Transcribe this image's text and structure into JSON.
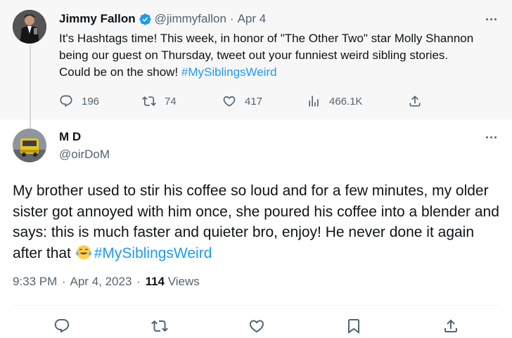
{
  "parent_tweet": {
    "display_name": "Jimmy Fallon",
    "handle": "@jimmyfallon",
    "separator": "·",
    "date": "Apr 4",
    "text_before": "It's Hashtags time! This week, in honor of \"The Other Two\" star Molly Shannon being our guest on Thursday, tweet out your funniest weird sibling stories. Could be on the show! ",
    "hashtag": "#MySiblingsWeird",
    "stats": {
      "replies": "196",
      "retweets": "74",
      "likes": "417",
      "views": "466.1K"
    }
  },
  "reply_tweet": {
    "display_name": "M D",
    "handle": "@oirDoM",
    "text_before": "My brother used to stir his coffee so loud and for a few minutes, my older sister got annoyed with him once, she poured his coffee into a blender and says: this is much faster and quieter bro, enjoy! He never done it again after that ",
    "emoji": "face-with-tears-of-joy",
    "hashtag": "#MySiblingsWeird",
    "time": "9:33 PM",
    "separator": "·",
    "date": "Apr 4, 2023",
    "views_count": "114",
    "views_label": "Views"
  },
  "colors": {
    "accent": "#1d9bf0",
    "muted": "#536471",
    "parent_bg": "#f7f7f7"
  }
}
